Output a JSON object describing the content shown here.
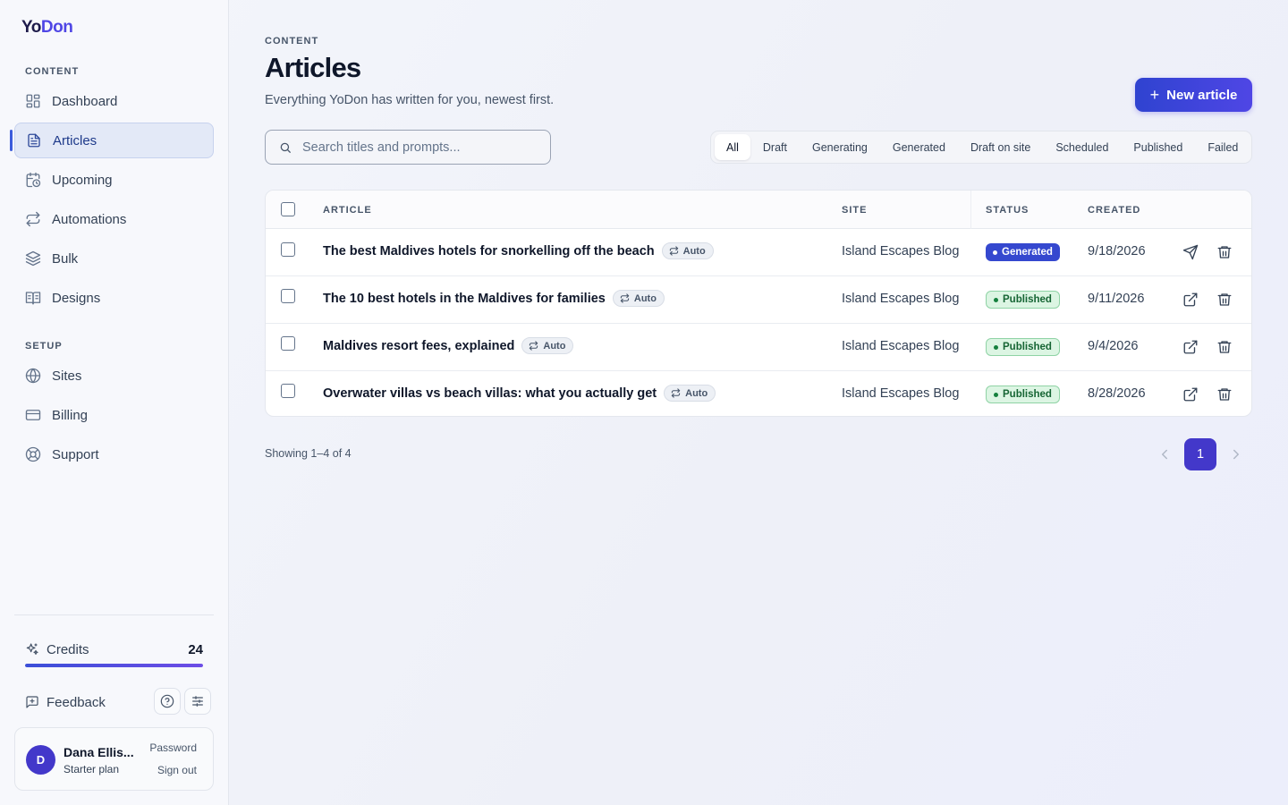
{
  "app": {
    "logo_part1": "Yo",
    "logo_part2": "Don"
  },
  "sidebar": {
    "content_label": "CONTENT",
    "setup_label": "SETUP",
    "items": [
      {
        "label": "Dashboard",
        "icon": "dashboard-icon"
      },
      {
        "label": "Articles",
        "icon": "document-icon",
        "active": true
      },
      {
        "label": "Upcoming",
        "icon": "calendar-clock-icon"
      },
      {
        "label": "Automations",
        "icon": "repeat-icon"
      },
      {
        "label": "Bulk",
        "icon": "layers-icon"
      },
      {
        "label": "Designs",
        "icon": "book-open-icon"
      }
    ],
    "setup_items": [
      {
        "label": "Sites",
        "icon": "globe-icon"
      },
      {
        "label": "Billing",
        "icon": "credit-card-icon"
      },
      {
        "label": "Support",
        "icon": "lifebuoy-icon"
      }
    ],
    "credits_label": "Credits",
    "credits_count": "24",
    "credits_fraction": 1.0,
    "feedback_label": "Feedback",
    "user": {
      "initial": "D",
      "name": "Dana Ellis...",
      "plan": "Starter plan",
      "password_link": "Password",
      "signout_link": "Sign out"
    }
  },
  "header": {
    "eyebrow": "CONTENT",
    "title": "Articles",
    "subtitle": "Everything YoDon has written for you, newest first.",
    "new_button": "New article",
    "new_button_icon": "+"
  },
  "search": {
    "placeholder": "Search titles and prompts...",
    "value": ""
  },
  "filters": [
    "All",
    "Draft",
    "Generating",
    "Generated",
    "Draft on site",
    "Scheduled",
    "Published",
    "Failed"
  ],
  "active_filter": "All",
  "table": {
    "columns": {
      "article": "ARTICLE",
      "site": "SITE",
      "status": "STATUS",
      "created": "CREATED"
    },
    "rows": [
      {
        "title": "The best Maldives hotels for snorkelling off the beach",
        "badge": "Auto",
        "site": "Island Escapes Blog",
        "status": "Generated",
        "created": "9/18/2026",
        "action": "send-icon"
      },
      {
        "title": "The 10 best hotels in the Maldives for families",
        "badge": "Auto",
        "site": "Island Escapes Blog",
        "status": "Published",
        "created": "9/11/2026",
        "action": "external-link-icon"
      },
      {
        "title": "Maldives resort fees, explained",
        "badge": "Auto",
        "site": "Island Escapes Blog",
        "status": "Published",
        "created": "9/4/2026",
        "action": "external-link-icon"
      },
      {
        "title": "Overwater villas vs beach villas: what you actually get",
        "badge": "Auto",
        "site": "Island Escapes Blog",
        "status": "Published",
        "created": "8/28/2026",
        "action": "external-link-icon"
      }
    ]
  },
  "pagination": {
    "showing": "Showing 1–4 of 4",
    "current_page": "1"
  },
  "colors": {
    "accent": "#4338ca",
    "generated": "#3548cf",
    "published_bg": "#dcf5e3",
    "published_text": "#166534"
  }
}
